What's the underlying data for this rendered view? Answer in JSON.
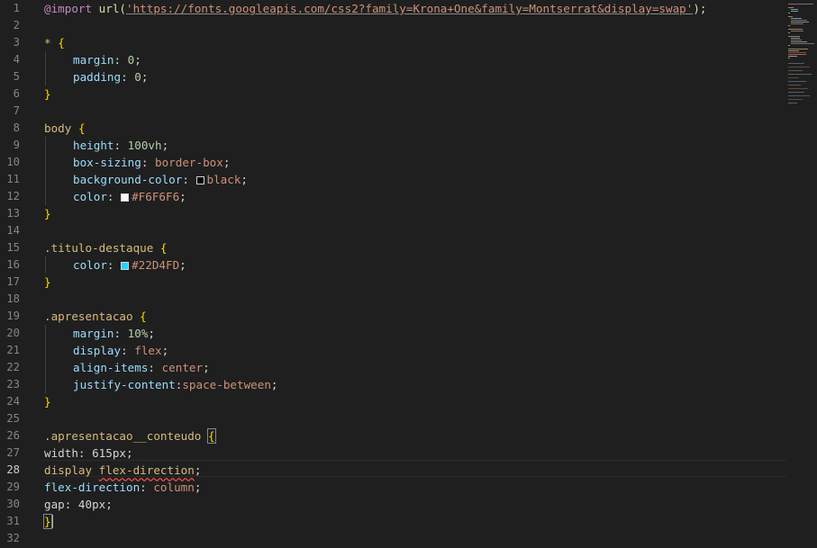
{
  "colors": {
    "background": "#1f1f1f",
    "selector": "#d7ba7d",
    "property": "#9cdcfe",
    "value": "#ce9178",
    "number": "#b5cea8",
    "brace": "#ffd700",
    "at_rule": "#c586c0",
    "function": "#dcdcaa",
    "line_number": "#858585"
  },
  "editor": {
    "active_line": 28,
    "line_numbers": [
      "1",
      "2",
      "3",
      "4",
      "5",
      "6",
      "7",
      "8",
      "9",
      "10",
      "11",
      "12",
      "13",
      "14",
      "15",
      "16",
      "17",
      "18",
      "19",
      "20",
      "21",
      "22",
      "23",
      "24",
      "25",
      "26",
      "27",
      "28",
      "29",
      "30",
      "31",
      "32"
    ],
    "lines": {
      "l1": {
        "at": "@import",
        "fn": "url(",
        "str": "'https://fonts.googleapis.com/css2?family=Krona+One&family=Montserrat&display=swap'",
        "end": ");"
      },
      "l3": {
        "sel": "*",
        "brace": "{"
      },
      "l4": {
        "prop": "margin",
        "colon": ": ",
        "num": "0",
        "semi": ";"
      },
      "l5": {
        "prop": "padding",
        "colon": ": ",
        "num": "0",
        "semi": ";"
      },
      "l6": {
        "brace": "}"
      },
      "l8": {
        "sel": "body",
        "brace": "{"
      },
      "l9": {
        "prop": "height",
        "colon": ": ",
        "num": "100vh",
        "semi": ";"
      },
      "l10": {
        "prop": "box-sizing",
        "colon": ": ",
        "val": "border-box",
        "semi": ";"
      },
      "l11": {
        "prop": "background-color",
        "colon": ": ",
        "val": "black",
        "semi": ";",
        "swatch": "#000000"
      },
      "l12": {
        "prop": "color",
        "colon": ": ",
        "val": "#F6F6F6",
        "semi": ";",
        "swatch": "#F6F6F6"
      },
      "l13": {
        "brace": "}"
      },
      "l15": {
        "sel": ".titulo-destaque",
        "brace": "{"
      },
      "l16": {
        "prop": "color",
        "colon": ": ",
        "val": "#22D4FD",
        "semi": ";",
        "swatch": "#22D4FD"
      },
      "l17": {
        "brace": "}"
      },
      "l19": {
        "sel": ".apresentacao",
        "brace": "{"
      },
      "l20": {
        "prop": "margin",
        "colon": ": ",
        "num": "10%",
        "semi": ";"
      },
      "l21": {
        "prop": "display",
        "colon": ": ",
        "val": "flex",
        "semi": ";"
      },
      "l22": {
        "prop": "align-items",
        "colon": ": ",
        "val": "center",
        "semi": ";"
      },
      "l23": {
        "prop": "justify-content",
        "colon": ":",
        "val": "space-between",
        "semi": ";"
      },
      "l24": {
        "brace": "}"
      },
      "l26": {
        "sel": ".apresentacao__conteudo",
        "brace": "{"
      },
      "l27": {
        "text": "width: 615px;"
      },
      "l28": {
        "a": "display ",
        "b": "flex-direction",
        "semi": ";"
      },
      "l29": {
        "prop": "flex-direction",
        "colon": ": ",
        "val": "column",
        "semi": ";"
      },
      "l30": {
        "text": "gap: 40px;"
      },
      "l31": {
        "brace": "}"
      }
    }
  }
}
